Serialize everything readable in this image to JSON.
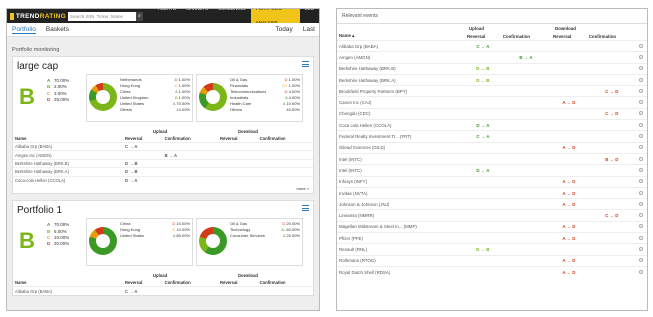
{
  "left": {
    "logo": {
      "brand_light": "TREND",
      "brand_bold": "RATING"
    },
    "search": {
      "placeholder": "Search ISIN, Ticker, Name",
      "icon": "search-icon"
    },
    "menu": [
      "ALERTS",
      "MARKETS",
      "SCREENING",
      "PORTFOLIO ANALYSIS",
      "SEC"
    ],
    "tabs": {
      "portfolio": "Portfolio",
      "baskets": "Baskets",
      "today": "Today",
      "last": "Last"
    },
    "section_label": "Portfolio monitoring",
    "cards": [
      {
        "title": "large cap",
        "grade": "B",
        "grades": [
          {
            "letter": "A",
            "value": "70.00%"
          },
          {
            "letter": "B",
            "value": "2.00%"
          },
          {
            "letter": "C",
            "value": "3.00%"
          },
          {
            "letter": "D",
            "value": "25.00%"
          }
        ],
        "donut1": {
          "labels": [
            "Netherlands",
            "Hong Kong",
            "China",
            "United Kingdom",
            "United States",
            "Others"
          ],
          "values": [
            {
              "g": "D",
              "v": "1.00%"
            },
            {
              "g": "C",
              "v": "1.00%"
            },
            {
              "g": "A",
              "v": "1.00%"
            },
            {
              "g": "B",
              "v": "1.00%"
            },
            {
              "g": "A",
              "v": "70.00%"
            },
            {
              "g": "",
              "v": "14.00%"
            }
          ],
          "colors": {
            "green": "#7cb518",
            "dark_green": "#3a9a25",
            "orange": "#e89b0c",
            "red": "#d23a1a"
          }
        },
        "donut2": {
          "labels": [
            "Oil & Gas",
            "Financials",
            "Telecommunications",
            "Industrials",
            "Health Care",
            "Others"
          ],
          "values": [
            {
              "g": "D",
              "v": "1.00%"
            },
            {
              "g": "C+",
              "v": "1.00%"
            },
            {
              "g": "D",
              "v": "4.00%"
            },
            {
              "g": "A",
              "v": "4.00%"
            },
            {
              "g": "A",
              "v": "10.00%"
            },
            {
              "g": "",
              "v": "40.00%"
            }
          ]
        },
        "table": {
          "upload": "Upload",
          "download": "Download",
          "name": "Name",
          "reversal": "Reversal",
          "confirmation": "Confirmation",
          "rows": [
            {
              "name": "Alibaba Grp (BABA)",
              "up_rev": "C → A",
              "up_conf": "",
              "dn_rev": "",
              "dn_conf": ""
            },
            {
              "name": "Amgen Inc (AMGN)",
              "up_rev": "",
              "up_conf": "B → A",
              "dn_rev": "",
              "dn_conf": ""
            },
            {
              "name": "Berkshire Hathaway (BRK.B)",
              "up_rev": "D → B",
              "up_conf": "",
              "dn_rev": "",
              "dn_conf": ""
            },
            {
              "name": "Berkshire Hathaway (BRK.A)",
              "up_rev": "D → B",
              "up_conf": "",
              "dn_rev": "",
              "dn_conf": ""
            },
            {
              "name": "Coca-cola Hellen (CCOLA)",
              "up_rev": "D → A",
              "up_conf": "",
              "dn_rev": "",
              "dn_conf": ""
            }
          ],
          "more": "more >"
        }
      },
      {
        "title": "Portfolio 1",
        "grade": "B",
        "grades": [
          {
            "letter": "A",
            "value": "70.00%"
          },
          {
            "letter": "B",
            "value": "5.00%"
          },
          {
            "letter": "C",
            "value": "10.00%"
          },
          {
            "letter": "D",
            "value": "20.00%"
          }
        ],
        "donut1": {
          "labels": [
            "China",
            "Hong Kong",
            "United States"
          ],
          "values": [
            {
              "g": "D",
              "v": "10.00%"
            },
            {
              "g": "C",
              "v": "10.00%"
            },
            {
              "g": "A",
              "v": "80.00%"
            }
          ]
        },
        "donut2": {
          "labels": [
            "Oil & Gas",
            "Technology",
            "Consumer Services"
          ],
          "values": [
            {
              "g": "D",
              "v": "20.00%"
            },
            {
              "g": "A-",
              "v": "60.00%"
            },
            {
              "g": "A",
              "v": "20.00%"
            }
          ]
        },
        "table": {
          "upload": "Upload",
          "download": "Download",
          "name": "Name",
          "reversal": "Reversal",
          "confirmation": "Confirmation",
          "rows": [
            {
              "name": "Alibaba Grp (BABA)",
              "up_rev": "C → A",
              "up_conf": "",
              "dn_rev": "",
              "dn_conf": ""
            }
          ]
        }
      }
    ]
  },
  "right": {
    "header": "Relevant events",
    "cols": {
      "name": "Name ▴",
      "upload": "Upload",
      "download": "Download",
      "reversal": "Reversal",
      "confirmation": "Confirmation"
    },
    "rows": [
      {
        "name": "Alibaba Grp (BABA)",
        "a": "C → A",
        "b": "",
        "c": "",
        "d": ""
      },
      {
        "name": "Amgen (AMGN)",
        "a": "",
        "b": "B → A",
        "c": "",
        "d": ""
      },
      {
        "name": "Berkshire Hathaway (BRK.B)",
        "a": "D → B",
        "b": "",
        "c": "",
        "d": ""
      },
      {
        "name": "Berkshire Hathaway (BRK.A)",
        "a": "D → B",
        "b": "",
        "c": "",
        "d": ""
      },
      {
        "name": "Brookfield Property Partners (BPY)",
        "a": "",
        "b": "",
        "c": "",
        "d": "C → D"
      },
      {
        "name": "Canon Inc (CAJ)",
        "a": "",
        "b": "",
        "c": "A → D",
        "d": ""
      },
      {
        "name": "Chengdu (CDC)",
        "a": "",
        "b": "",
        "c": "",
        "d": "C → D"
      },
      {
        "name": "Coca cola Hellen (CCOLA)",
        "a": "D → A",
        "b": "",
        "c": "",
        "d": ""
      },
      {
        "name": "Federal Realty Investment Tr... (FRT)",
        "a": "C → A",
        "b": "",
        "c": "",
        "d": ""
      },
      {
        "name": "Gilead Sciences (GILD)",
        "a": "",
        "b": "",
        "c": "A → D",
        "d": ""
      },
      {
        "name": "Intel (INTC)",
        "a": "",
        "b": "",
        "c": "",
        "d": "B → D"
      },
      {
        "name": "Intel (INTC)",
        "a": "D → A",
        "b": "",
        "c": "",
        "d": ""
      },
      {
        "name": "Infosys (INFY)",
        "a": "",
        "b": "",
        "c": "A → D",
        "d": ""
      },
      {
        "name": "Invitae (NVTA)",
        "a": "",
        "b": "",
        "c": "A → D",
        "d": ""
      },
      {
        "name": "Johnson & Johnson (JNJ)",
        "a": "",
        "b": "",
        "c": "A → D",
        "d": ""
      },
      {
        "name": "Lineamia (NMRR)",
        "a": "",
        "b": "",
        "c": "",
        "d": "C → D"
      },
      {
        "name": "Magellan Midstream & Steel In... (MMP)",
        "a": "",
        "b": "",
        "c": "A → D",
        "d": ""
      },
      {
        "name": "Pfizer (PFE)",
        "a": "",
        "b": "",
        "c": "A → D",
        "d": ""
      },
      {
        "name": "Renault (RNL)",
        "a": "D → B",
        "b": "",
        "c": "",
        "d": ""
      },
      {
        "name": "Rothmans (RTOG)",
        "a": "",
        "b": "",
        "c": "A → D",
        "d": ""
      },
      {
        "name": "Royal Dutch Shell (RDSA)",
        "a": "",
        "b": "",
        "c": "A → D",
        "d": ""
      }
    ]
  }
}
